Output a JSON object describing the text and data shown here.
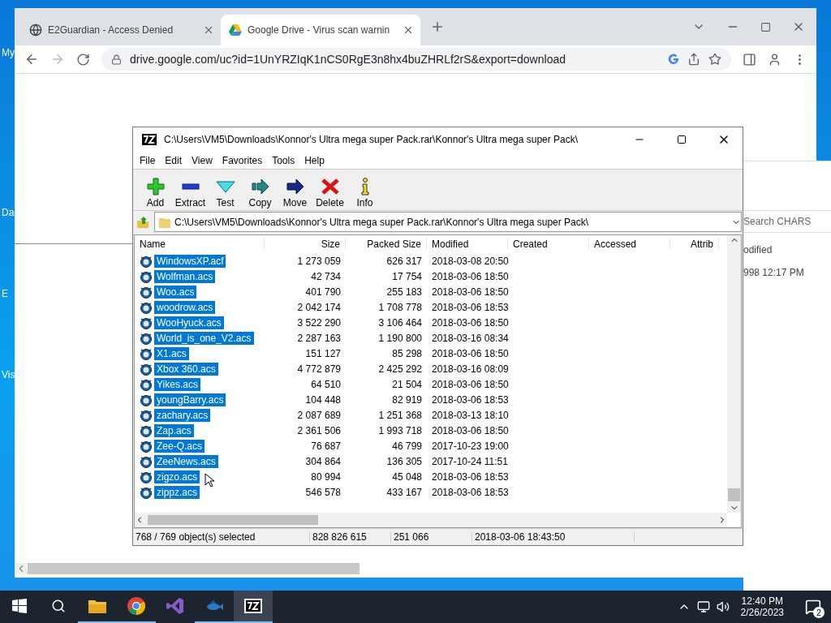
{
  "desktop_icons": [
    {
      "label": "My"
    },
    {
      "label": "Da"
    },
    {
      "label": "E"
    },
    {
      "label": "Vis"
    }
  ],
  "browser": {
    "tabs": [
      {
        "title": "E2Guardian - Access Denied",
        "kind": "globe",
        "selected": false
      },
      {
        "title": "Google Drive - Virus scan warnin",
        "kind": "drive",
        "selected": true
      }
    ],
    "url": "drive.google.com/uc?id=1UnYRZIqK1nCS0RgE3n8hx4buZHRLf2rS&export=download"
  },
  "explorer": {
    "search_placeholder": "Search CHARS",
    "column": "odified",
    "row": "998 12:17 PM"
  },
  "archive": {
    "title": "C:\\Users\\VM5\\Downloads\\Konnor's Ultra mega super Pack.rar\\Konnor's Ultra mega super Pack\\",
    "menu": [
      "File",
      "Edit",
      "View",
      "Favorites",
      "Tools",
      "Help"
    ],
    "toolbar": [
      {
        "label": "Add",
        "kind": "add"
      },
      {
        "label": "Extract",
        "kind": "extract"
      },
      {
        "label": "Test",
        "kind": "test"
      },
      {
        "label": "Copy",
        "kind": "copy"
      },
      {
        "label": "Move",
        "kind": "move"
      },
      {
        "label": "Delete",
        "kind": "delete"
      },
      {
        "label": "Info",
        "kind": "info"
      }
    ],
    "path": "C:\\Users\\VM5\\Downloads\\Konnor's Ultra mega super Pack.rar\\Konnor's Ultra mega super Pack\\",
    "columns": [
      "Name",
      "Size",
      "Packed Size",
      "Modified",
      "Created",
      "Accessed",
      "Attrib"
    ],
    "rows": [
      {
        "name": "WindowsXP.acf",
        "size": "1 273 059",
        "packed": "626 317",
        "modified": "2018-03-08 20:50",
        "selected": true
      },
      {
        "name": "Wolfman.acs",
        "size": "42 734",
        "packed": "17 754",
        "modified": "2018-03-06 18:50",
        "selected": true
      },
      {
        "name": "Woo.acs",
        "size": "401 790",
        "packed": "255 183",
        "modified": "2018-03-06 18:50",
        "selected": true
      },
      {
        "name": "woodrow.acs",
        "size": "2 042 174",
        "packed": "1 708 778",
        "modified": "2018-03-06 18:53",
        "selected": true
      },
      {
        "name": "WooHyuck.acs",
        "size": "3 522 290",
        "packed": "3 106 464",
        "modified": "2018-03-06 18:50",
        "selected": true
      },
      {
        "name": "World_is_one_V2.acs",
        "size": "2 287 163",
        "packed": "1 190 800",
        "modified": "2018-03-16 08:34",
        "selected": true
      },
      {
        "name": "X1.acs",
        "size": "151 127",
        "packed": "85 298",
        "modified": "2018-03-06 18:50",
        "selected": true
      },
      {
        "name": "Xbox 360.acs",
        "size": "4 772 879",
        "packed": "2 425 292",
        "modified": "2018-03-16 08:09",
        "selected": true
      },
      {
        "name": "Yikes.acs",
        "size": "64 510",
        "packed": "21 504",
        "modified": "2018-03-06 18:50",
        "selected": true
      },
      {
        "name": "youngBarry.acs",
        "size": "104 448",
        "packed": "82 919",
        "modified": "2018-03-06 18:53",
        "selected": true
      },
      {
        "name": "zachary.acs",
        "size": "2 087 689",
        "packed": "1 251 368",
        "modified": "2018-03-13 18:10",
        "selected": true
      },
      {
        "name": "Zap.acs",
        "size": "2 361 506",
        "packed": "1 993 718",
        "modified": "2018-03-06 18:50",
        "selected": true
      },
      {
        "name": "Zee-Q.acs",
        "size": "76 687",
        "packed": "46 799",
        "modified": "2017-10-23 19:00",
        "selected": true
      },
      {
        "name": "ZeeNews.acs",
        "size": "304 864",
        "packed": "136 305",
        "modified": "2017-10-24 11:51",
        "selected": true
      },
      {
        "name": "zigzo.acs",
        "size": "80 994",
        "packed": "45 048",
        "modified": "2018-03-06 18:53",
        "selected": true
      },
      {
        "name": "zippz.acs",
        "size": "546 578",
        "packed": "433 167",
        "modified": "2018-03-06 18:53",
        "selected": true
      }
    ],
    "status": [
      "768 / 769 object(s) selected",
      "828 826 615",
      "251 066",
      "2018-03-06 18:43:50"
    ]
  },
  "taskbar": {
    "apps": [
      {
        "kind": "folder",
        "running": true,
        "selected": false
      },
      {
        "kind": "chrome",
        "running": true,
        "selected": false
      },
      {
        "kind": "studio",
        "running": false,
        "selected": false
      },
      {
        "kind": "fish",
        "running": true,
        "selected": false
      },
      {
        "kind": "sevenzip",
        "running": true,
        "selected": true
      }
    ],
    "time": "12:40 PM",
    "date": "2/26/2023",
    "notifications": "2"
  }
}
